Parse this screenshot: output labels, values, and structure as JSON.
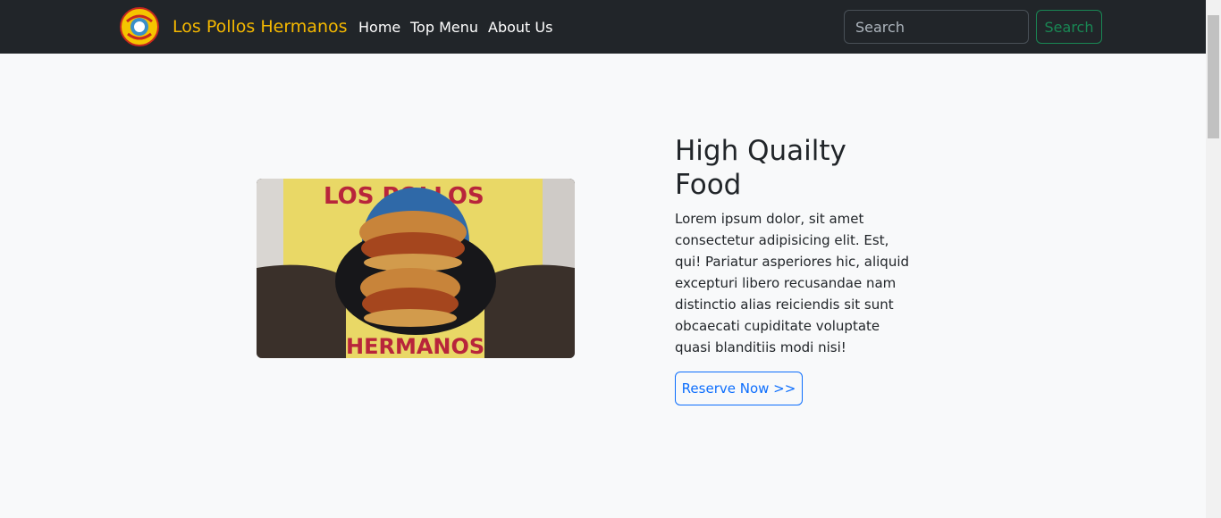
{
  "navbar": {
    "brand": "Los Pollos Hermanos",
    "logo_icon": "los-pollos-hermanos-logo",
    "links": [
      "Home",
      "Top Menu",
      "About Us"
    ],
    "search": {
      "placeholder": "Search",
      "button_label": "Search"
    }
  },
  "hero": {
    "image_icon": "chicken-sandwich-photo",
    "title": "High Quailty Food",
    "body": "Lorem ipsum dolor, sit amet consectetur adipisicing elit. Est, qui! Pariatur asperiores hic, aliquid excepturi libero recusandae nam distinctio alias reiciendis sit sunt obcaecati cupiditate voluptate quasi blanditiis modi nisi!",
    "cta_label": "Reserve Now >>"
  },
  "colors": {
    "navbar_bg": "#212529",
    "brand": "#f5b800",
    "search_button": "#198754",
    "cta": "#0d6efd",
    "page_bg": "#f8f9fa"
  }
}
